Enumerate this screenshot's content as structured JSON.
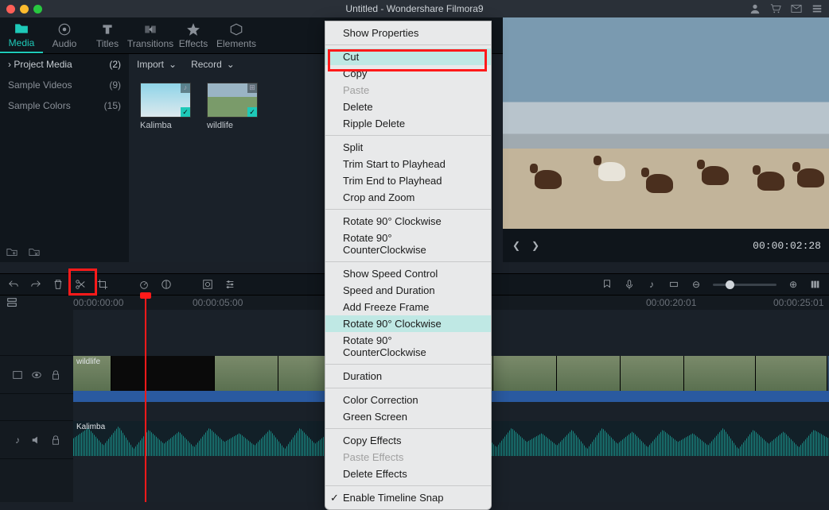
{
  "window": {
    "title": "Untitled - Wondershare Filmora9"
  },
  "top_icons": [
    "user",
    "cart",
    "mail",
    "gear"
  ],
  "tabs": [
    {
      "label": "Media",
      "active": true
    },
    {
      "label": "Audio"
    },
    {
      "label": "Titles"
    },
    {
      "label": "Transitions"
    },
    {
      "label": "Effects"
    },
    {
      "label": "Elements"
    }
  ],
  "sidebar": {
    "items": [
      {
        "label": "Project Media",
        "count": "(2)",
        "head": true
      },
      {
        "label": "Sample Videos",
        "count": "(9)"
      },
      {
        "label": "Sample Colors",
        "count": "(15)"
      }
    ]
  },
  "media_toolbar": {
    "import": "Import",
    "record": "Record"
  },
  "thumbs": [
    {
      "label": "Kalimba",
      "kind": "k",
      "tag": "♪"
    },
    {
      "label": "wildlife",
      "kind": "w",
      "tag": "⊞"
    }
  ],
  "preview": {
    "time": "00:00:02:28"
  },
  "ruler": [
    "00:00:00:00",
    "00:00:05:00",
    "00:00:20:01",
    "00:00:25:01"
  ],
  "tracks": {
    "video_label": "wildlife",
    "audio_label": "Kalimba"
  },
  "context_menu": [
    {
      "t": "Show Properties"
    },
    {
      "sep": true
    },
    {
      "t": "Cut",
      "hl": true
    },
    {
      "t": "Copy"
    },
    {
      "t": "Paste",
      "disabled": true
    },
    {
      "t": "Delete"
    },
    {
      "t": "Ripple Delete"
    },
    {
      "sep": true
    },
    {
      "t": "Split"
    },
    {
      "t": "Trim Start to Playhead"
    },
    {
      "t": "Trim End to Playhead"
    },
    {
      "t": "Crop and Zoom"
    },
    {
      "sep": true
    },
    {
      "t": "Rotate 90° Clockwise"
    },
    {
      "t": "Rotate 90° CounterClockwise"
    },
    {
      "sep": true
    },
    {
      "t": "Show Speed Control"
    },
    {
      "t": "Speed and Duration"
    },
    {
      "t": "Add Freeze Frame"
    },
    {
      "t": "Rotate 90° Clockwise",
      "hl": true
    },
    {
      "t": "Rotate 90° CounterClockwise"
    },
    {
      "sep": true
    },
    {
      "t": "Duration"
    },
    {
      "sep": true
    },
    {
      "t": "Color Correction"
    },
    {
      "t": "Green Screen"
    },
    {
      "sep": true
    },
    {
      "t": "Copy Effects"
    },
    {
      "t": "Paste Effects",
      "disabled": true
    },
    {
      "t": "Delete Effects"
    },
    {
      "sep": true
    },
    {
      "t": "Enable Timeline Snap",
      "check": true
    }
  ]
}
